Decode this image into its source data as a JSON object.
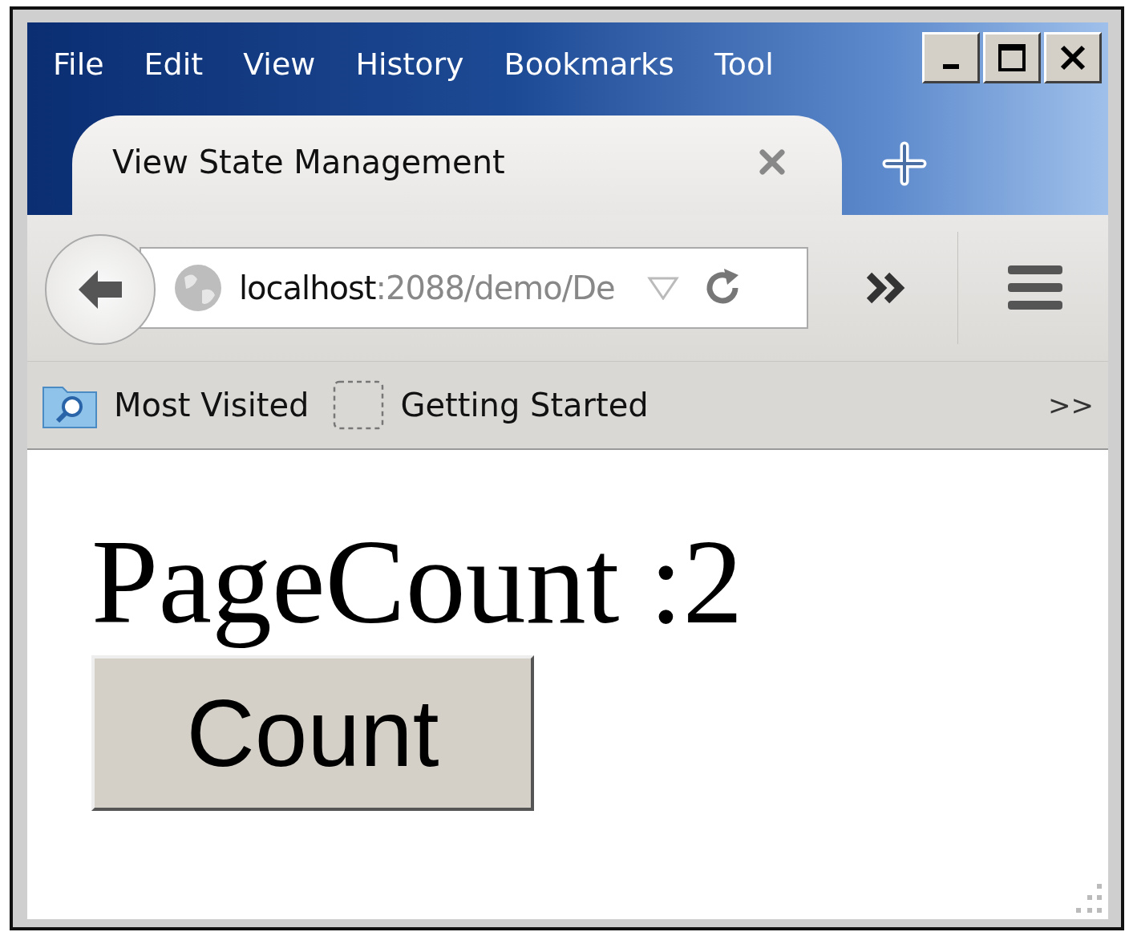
{
  "menu": [
    {
      "label": "File"
    },
    {
      "label": "Edit"
    },
    {
      "label": "View"
    },
    {
      "label": "History"
    },
    {
      "label": "Bookmarks"
    },
    {
      "label": "Tool"
    }
  ],
  "tab": {
    "title": "View State Management"
  },
  "address_bar": {
    "host": "localhost",
    "path": ":2088/demo/De"
  },
  "bookmarks": [
    {
      "label": "Most Visited",
      "kind": "folder"
    },
    {
      "label": "Getting Started",
      "kind": "page"
    }
  ],
  "bookmarks_overflow": ">>",
  "page": {
    "heading": "PageCount :2",
    "button": "Count"
  }
}
